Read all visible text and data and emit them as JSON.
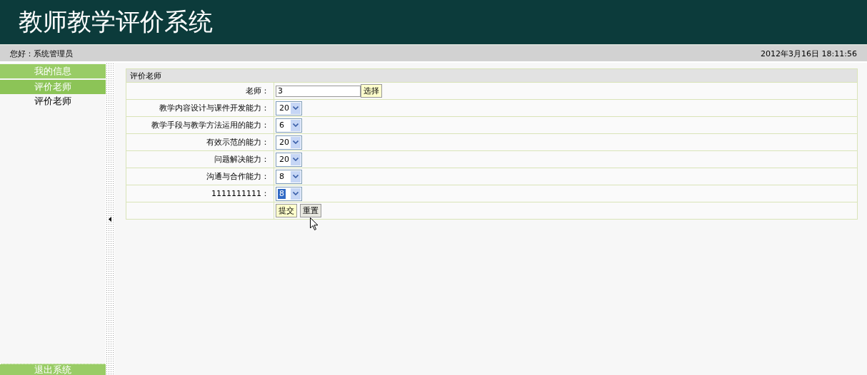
{
  "header": {
    "title": "教师教学评价系统"
  },
  "info_bar": {
    "greeting": "您好：系统管理员",
    "datetime": "2012年3月16日  18:11:56"
  },
  "sidebar": {
    "items": [
      {
        "kind": "header",
        "label": "我的信息",
        "selected": false
      },
      {
        "kind": "header",
        "label": "评价老师",
        "selected": true
      },
      {
        "kind": "link",
        "label": "评价老师",
        "selected": false
      }
    ],
    "exit_button": "退出系统"
  },
  "form": {
    "title": "评价老师",
    "rows": [
      {
        "kind": "text",
        "label": "老师：",
        "value": "3",
        "button": "选择"
      },
      {
        "kind": "select",
        "label": "教学内容设计与课件开发能力：",
        "value": "20",
        "highlighted": false
      },
      {
        "kind": "select",
        "label": "教学手段与教学方法运用的能力：",
        "value": "6",
        "highlighted": false
      },
      {
        "kind": "select",
        "label": "有效示范的能力：",
        "value": "20",
        "highlighted": false
      },
      {
        "kind": "select",
        "label": "问题解决能力：",
        "value": "20",
        "highlighted": false
      },
      {
        "kind": "select",
        "label": "沟通与合作能力：",
        "value": "8",
        "highlighted": false
      },
      {
        "kind": "select",
        "label": "1111111111：",
        "value": "8",
        "highlighted": true
      }
    ],
    "buttons": [
      "提交",
      "重置"
    ]
  }
}
